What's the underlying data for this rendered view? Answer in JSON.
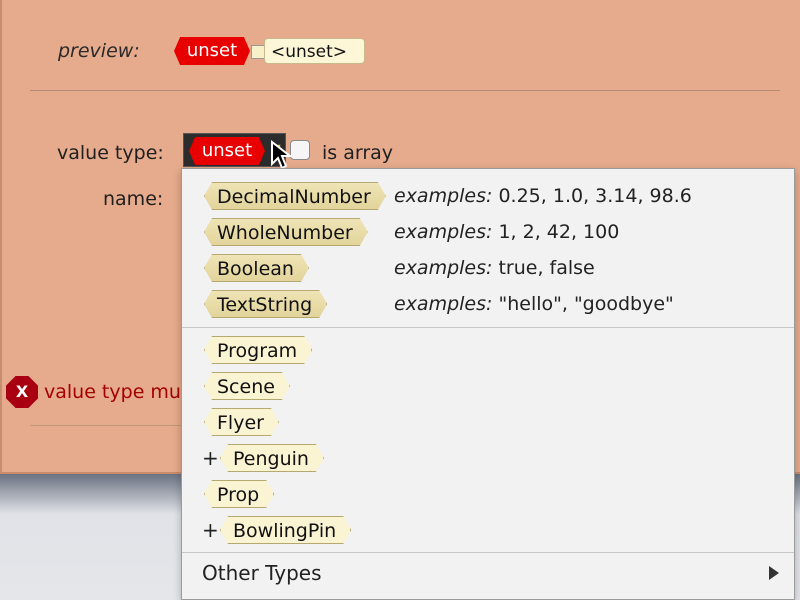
{
  "preview": {
    "label": "preview:",
    "unset_tag": "unset",
    "unset_value": "<unset>"
  },
  "form": {
    "value_type_label": "value type:",
    "value_type_selected": "unset",
    "is_array_label": "is array",
    "name_label": "name:"
  },
  "error": {
    "icon_letter": "X",
    "message": "value type mus"
  },
  "menu": {
    "primitive_types": [
      {
        "label": "DecimalNumber",
        "examples_prefix": "examples:",
        "examples": "0.25, 1.0, 3.14, 98.6"
      },
      {
        "label": "WholeNumber",
        "examples_prefix": "examples:",
        "examples": "1, 2, 42, 100"
      },
      {
        "label": "Boolean",
        "examples_prefix": "examples:",
        "examples": "true, false"
      },
      {
        "label": "TextString",
        "examples_prefix": "examples:",
        "examples": "\"hello\", \"goodbye\""
      }
    ],
    "class_types": [
      {
        "label": "Program",
        "expandable": false,
        "plus": ""
      },
      {
        "label": "Scene",
        "expandable": false,
        "plus": ""
      },
      {
        "label": "Flyer",
        "expandable": false,
        "plus": ""
      },
      {
        "label": "Penguin",
        "expandable": true,
        "plus": "+"
      },
      {
        "label": "Prop",
        "expandable": false,
        "plus": ""
      },
      {
        "label": "BowlingPin",
        "expandable": true,
        "plus": "+"
      }
    ],
    "other_types_label": "Other Types"
  },
  "colors": {
    "dialog_bg": "#e6ab8c",
    "unset_red": "#e80000",
    "error_red": "#a50000"
  }
}
